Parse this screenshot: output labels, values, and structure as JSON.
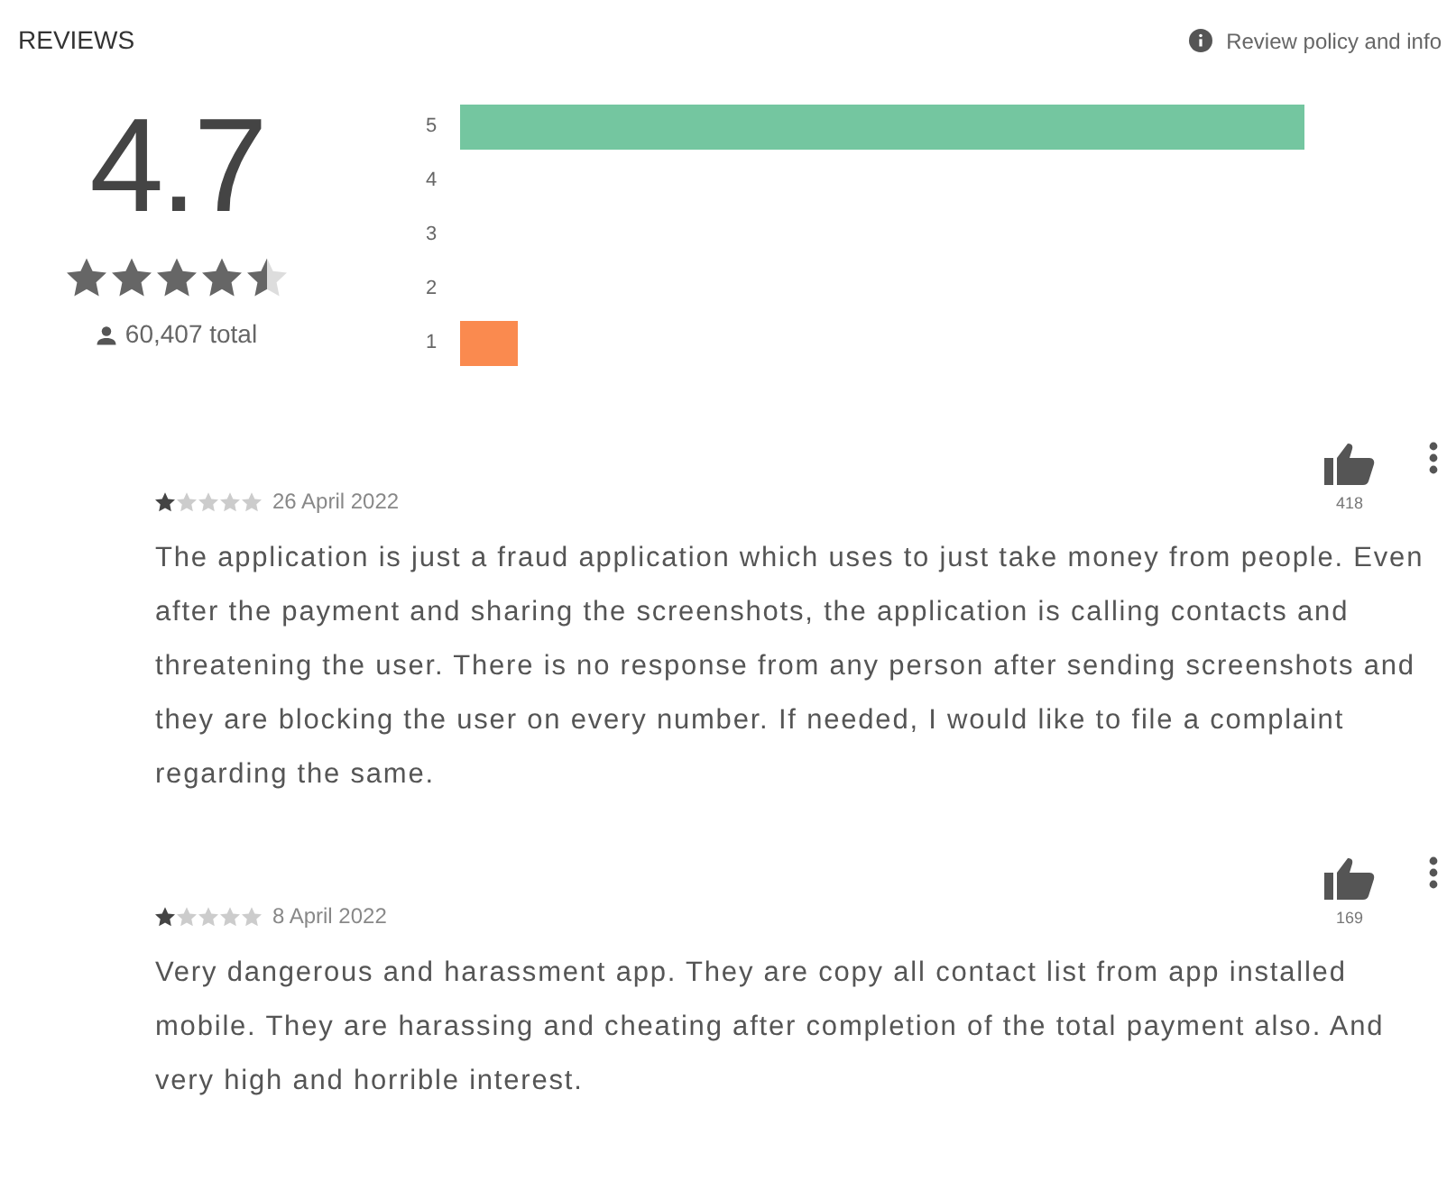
{
  "header": {
    "title": "REVIEWS",
    "policy_link": "Review policy and info"
  },
  "summary": {
    "rating": "4.7",
    "stars": 4.5,
    "total": "60,407 total"
  },
  "histogram": [
    {
      "label": "5",
      "color": "#74c6a0"
    },
    {
      "label": "4"
    },
    {
      "label": "3"
    },
    {
      "label": "2"
    },
    {
      "label": "1",
      "color": "#fa8a4f"
    }
  ],
  "reviews": [
    {
      "stars": 1,
      "date": "26 April 2022",
      "likes": "418",
      "text": "The application is just a fraud application which uses to just take money from people. Even after the payment and sharing the screenshots, the application is calling contacts and threatening the user. There is no response from any person after sending screenshots and they are blocking the user on every number. If needed, I would like to file a complaint regarding the same."
    },
    {
      "stars": 1,
      "date": "8 April 2022",
      "likes": "169",
      "text": "Very dangerous and harassment app. They are copy all contact list from app installed mobile. They are harassing and cheating after completion of the total payment also. And very high and horrible interest."
    }
  ]
}
